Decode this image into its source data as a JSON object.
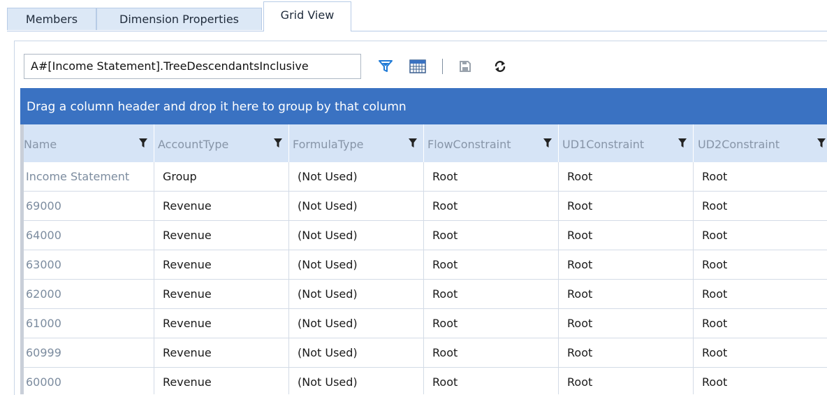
{
  "tabs": [
    {
      "label": "Members"
    },
    {
      "label": "Dimension Properties"
    },
    {
      "label": "Grid View"
    }
  ],
  "toolbar": {
    "filter_value": "A#[Income Statement].TreeDescendantsInclusive",
    "icons": [
      "filter-icon",
      "grid-icon",
      "save-icon",
      "refresh-icon"
    ]
  },
  "group_panel": {
    "text": "Drag a column header and drop it here to group by that column"
  },
  "grid": {
    "columns": [
      "Name",
      "AccountType",
      "FormulaType",
      "FlowConstraint",
      "UD1Constraint",
      "UD2Constraint"
    ],
    "rows": [
      [
        "Income Statement",
        "Group",
        "(Not Used)",
        "Root",
        "Root",
        "Root"
      ],
      [
        "69000",
        "Revenue",
        "(Not Used)",
        "Root",
        "Root",
        "Root"
      ],
      [
        "64000",
        "Revenue",
        "(Not Used)",
        "Root",
        "Root",
        "Root"
      ],
      [
        "63000",
        "Revenue",
        "(Not Used)",
        "Root",
        "Root",
        "Root"
      ],
      [
        "62000",
        "Revenue",
        "(Not Used)",
        "Root",
        "Root",
        "Root"
      ],
      [
        "61000",
        "Revenue",
        "(Not Used)",
        "Root",
        "Root",
        "Root"
      ],
      [
        "60999",
        "Revenue",
        "(Not Used)",
        "Root",
        "Root",
        "Root"
      ],
      [
        "60000",
        "Revenue",
        "(Not Used)",
        "Root",
        "Root",
        "Root"
      ]
    ]
  },
  "colors": {
    "accent": "#3a72c2",
    "header_bg": "#d6e4f6",
    "tab_bg": "#dce8f6"
  }
}
